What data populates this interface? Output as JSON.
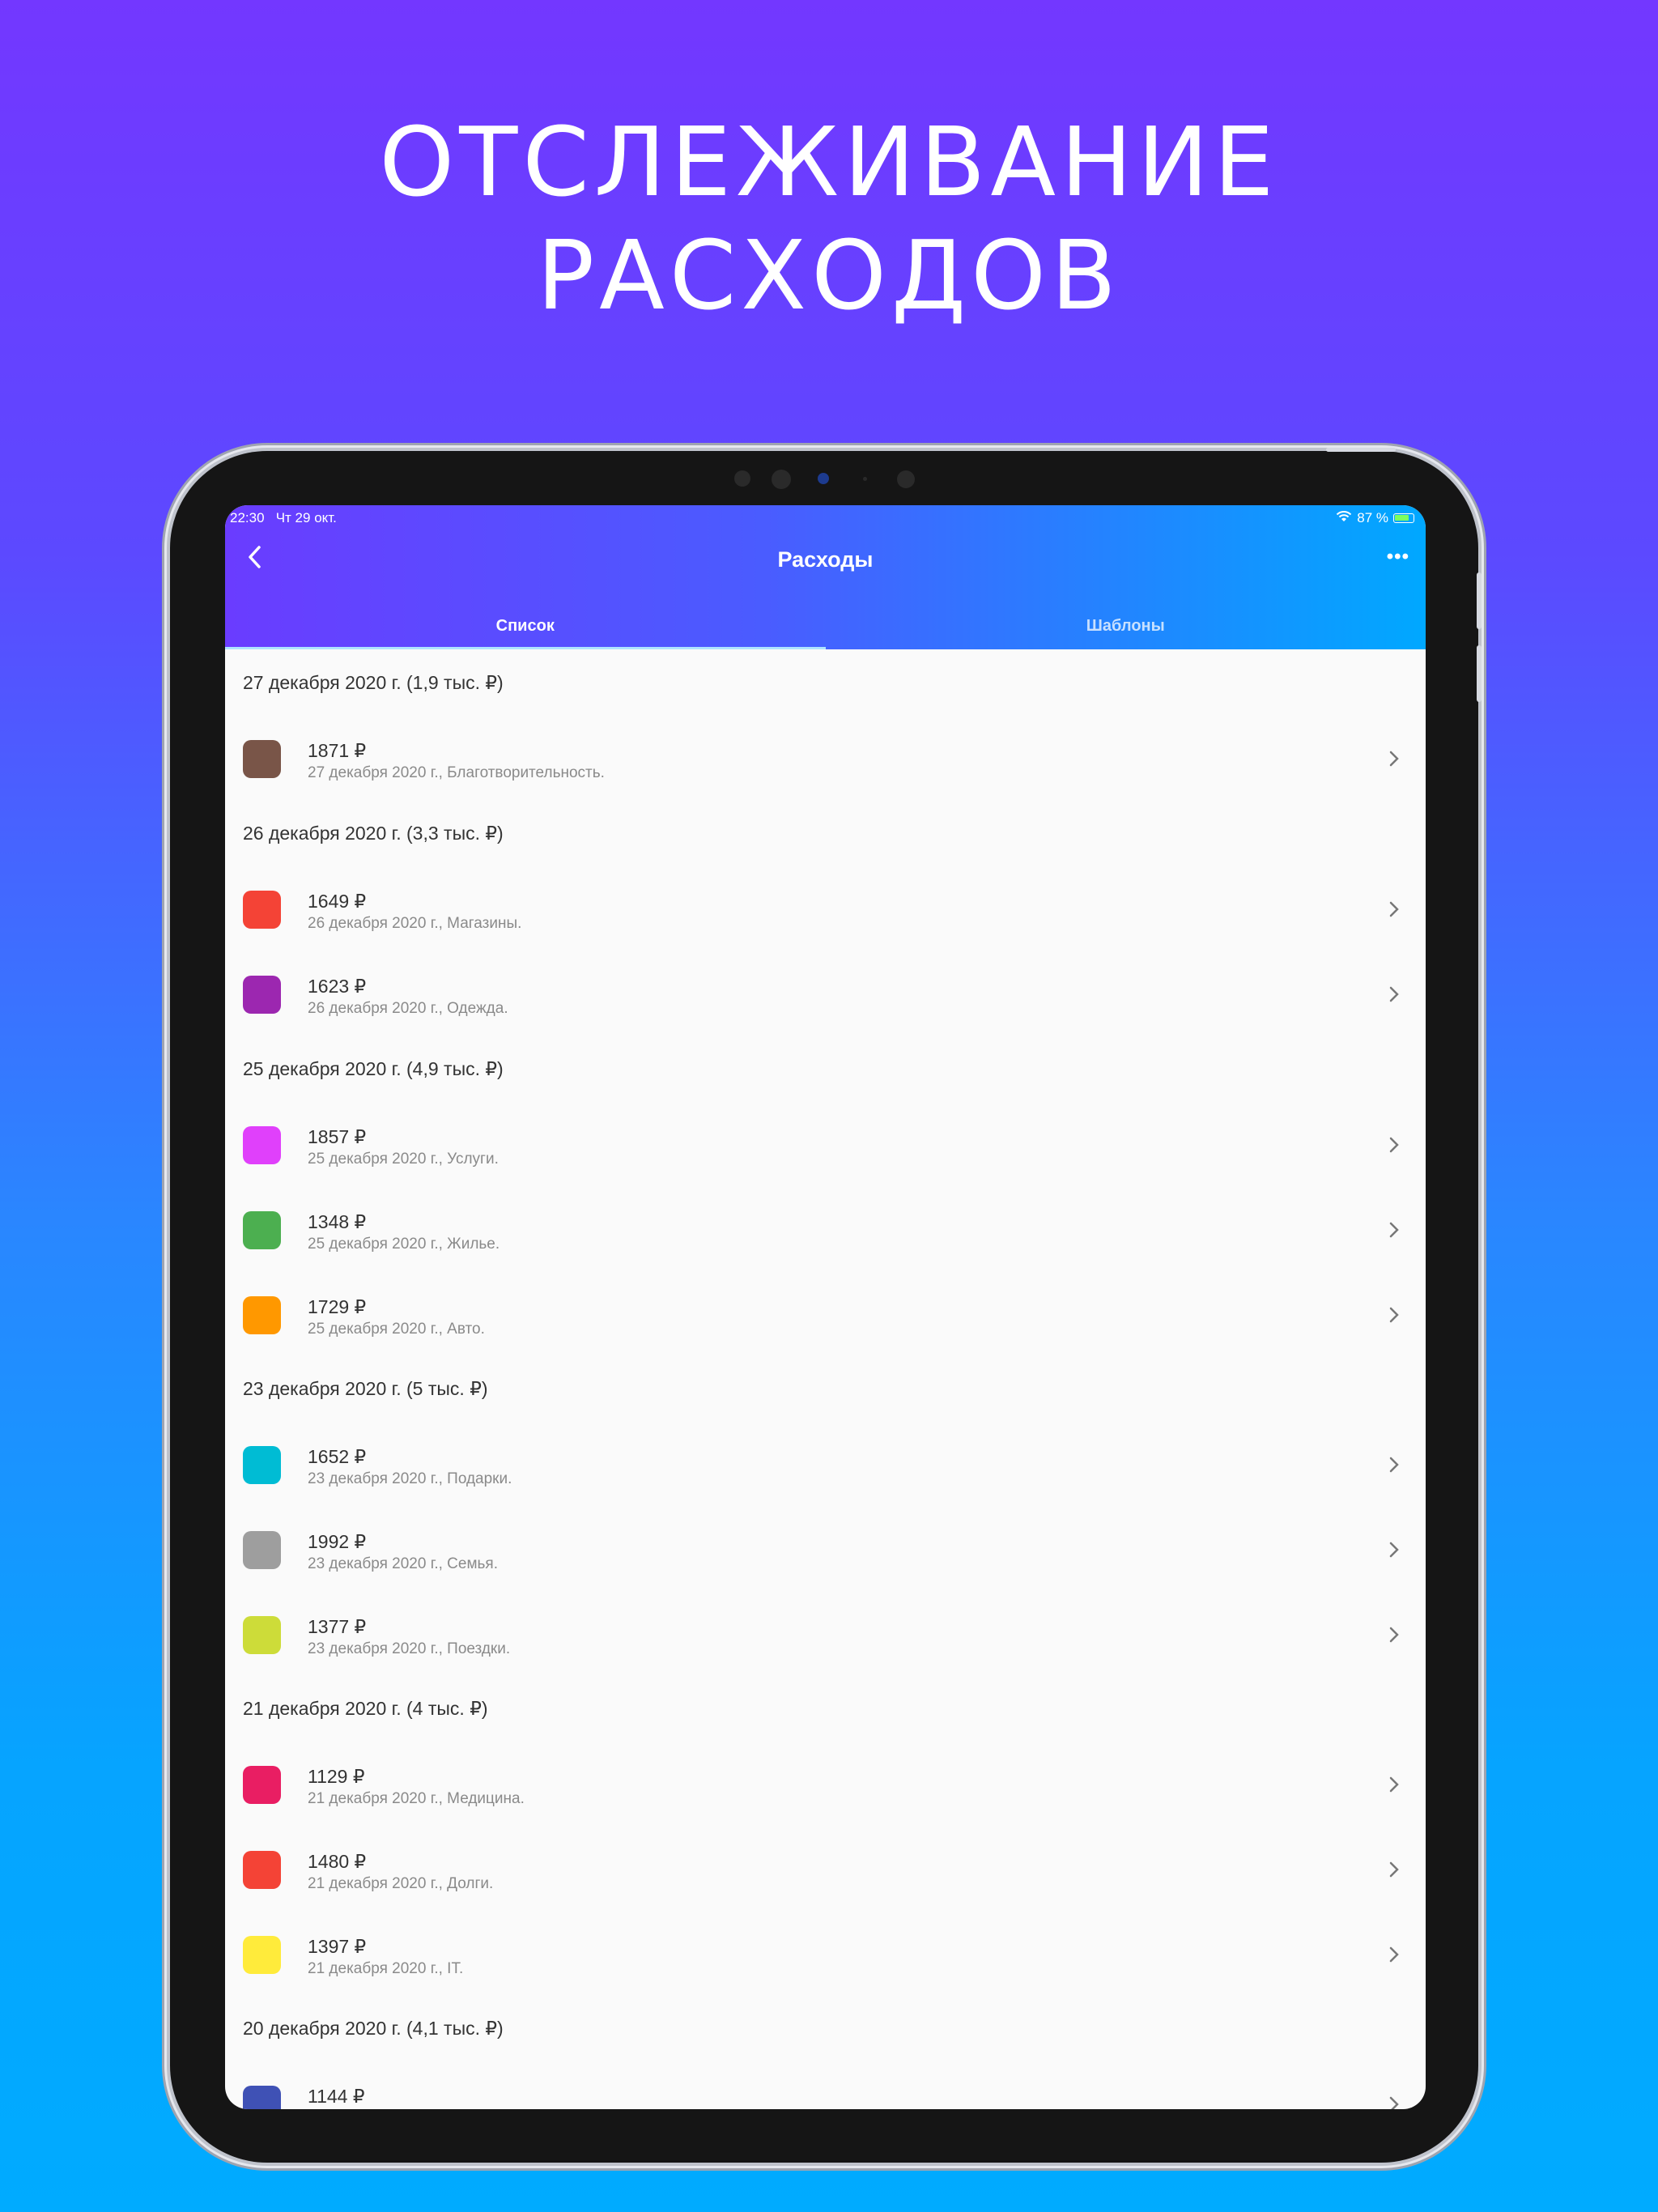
{
  "headline": {
    "line1": "ОТСЛЕЖИВАНИЕ",
    "line2": "РАСХОДОВ"
  },
  "status_bar": {
    "time": "22:30",
    "date": "Чт 29 окт.",
    "battery": "87 %"
  },
  "app_bar": {
    "title": "Расходы",
    "more": "•••"
  },
  "tabs": [
    {
      "label": "Список",
      "active": true
    },
    {
      "label": "Шаблоны",
      "active": false
    }
  ],
  "sections": [
    {
      "header": "27 декабря 2020 г. (1,9 тыс. ₽)",
      "items": [
        {
          "amount": "1871 ₽",
          "desc": "27 декабря 2020 г., Благотворительность.",
          "color": "#795548"
        }
      ]
    },
    {
      "header": "26 декабря 2020 г. (3,3 тыс. ₽)",
      "items": [
        {
          "amount": "1649 ₽",
          "desc": "26 декабря 2020 г., Магазины.",
          "color": "#F44336"
        },
        {
          "amount": "1623 ₽",
          "desc": "26 декабря 2020 г., Одежда.",
          "color": "#9C27B0"
        }
      ]
    },
    {
      "header": "25 декабря 2020 г. (4,9 тыс. ₽)",
      "items": [
        {
          "amount": "1857 ₽",
          "desc": "25 декабря 2020 г., Услуги.",
          "color": "#E040FB"
        },
        {
          "amount": "1348 ₽",
          "desc": "25 декабря 2020 г., Жилье.",
          "color": "#4CAF50"
        },
        {
          "amount": "1729 ₽",
          "desc": "25 декабря 2020 г., Авто.",
          "color": "#FF9800"
        }
      ]
    },
    {
      "header": "23 декабря 2020 г. (5 тыс. ₽)",
      "items": [
        {
          "amount": "1652 ₽",
          "desc": "23 декабря 2020 г., Подарки.",
          "color": "#00BCD4"
        },
        {
          "amount": "1992 ₽",
          "desc": "23 декабря 2020 г., Семья.",
          "color": "#9E9E9E"
        },
        {
          "amount": "1377 ₽",
          "desc": "23 декабря 2020 г., Поездки.",
          "color": "#CDDC39"
        }
      ]
    },
    {
      "header": "21 декабря 2020 г. (4 тыс. ₽)",
      "items": [
        {
          "amount": "1129 ₽",
          "desc": "21 декабря 2020 г., Медицина.",
          "color": "#E91E63"
        },
        {
          "amount": "1480 ₽",
          "desc": "21 декабря 2020 г., Долги.",
          "color": "#F44336"
        },
        {
          "amount": "1397 ₽",
          "desc": "21 декабря 2020 г., IT.",
          "color": "#FFEB3B"
        }
      ]
    },
    {
      "header": "20 декабря 2020 г. (4,1 тыс. ₽)",
      "items": [
        {
          "amount": "1144 ₽",
          "desc": "",
          "color": "#3F51B5"
        }
      ]
    }
  ]
}
